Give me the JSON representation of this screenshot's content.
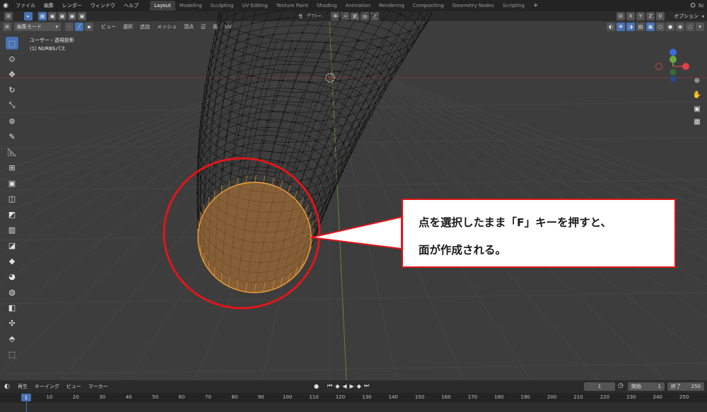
{
  "menubar": {
    "app_icon": "blender-logo-icon",
    "menus": [
      "ファイル",
      "編集",
      "レンダー",
      "ウィンドウ",
      "ヘルプ"
    ],
    "workspaces": [
      "Layout",
      "Modeling",
      "Sculpting",
      "UV Editing",
      "Texture Paint",
      "Shading",
      "Animation",
      "Rendering",
      "Compositing",
      "Geometry Nodes",
      "Scripting"
    ],
    "active_workspace": "Layout",
    "add_workspace": "+",
    "scene_label": "Sc"
  },
  "tool_header": {
    "transform_orientation": "グロー...",
    "options_label": "オプション",
    "axes": [
      "X",
      "Y",
      "Z"
    ]
  },
  "viewport_header": {
    "mode": "編集モード",
    "menus": [
      "ビュー",
      "選択",
      "追加",
      "メッシュ",
      "頂点",
      "辺",
      "面",
      "UV"
    ]
  },
  "viewport": {
    "view_name": "ユーザー・透視投影",
    "object_name": "(1) NURBSパス"
  },
  "callout": {
    "line1": "点を選択したまま「F」キーを押すと、",
    "line2": "面が作成される。"
  },
  "timeline": {
    "menus": [
      "再生",
      "キーイング",
      "ビュー",
      "マーカー"
    ],
    "current_frame": "1",
    "start_label": "開始",
    "start_value": "1",
    "end_label": "終了",
    "end_value": "250",
    "ticks": [
      "10",
      "20",
      "30",
      "40",
      "50",
      "60",
      "70",
      "80",
      "90",
      "100",
      "110",
      "120",
      "130",
      "140",
      "150",
      "160",
      "170",
      "180",
      "190",
      "200",
      "210",
      "220",
      "230",
      "240",
      "250"
    ],
    "playhead_label": "1"
  },
  "colors": {
    "selection_orange": "#e8902f",
    "highlight_red": "#e0161b",
    "accent_blue": "#4772b3"
  }
}
